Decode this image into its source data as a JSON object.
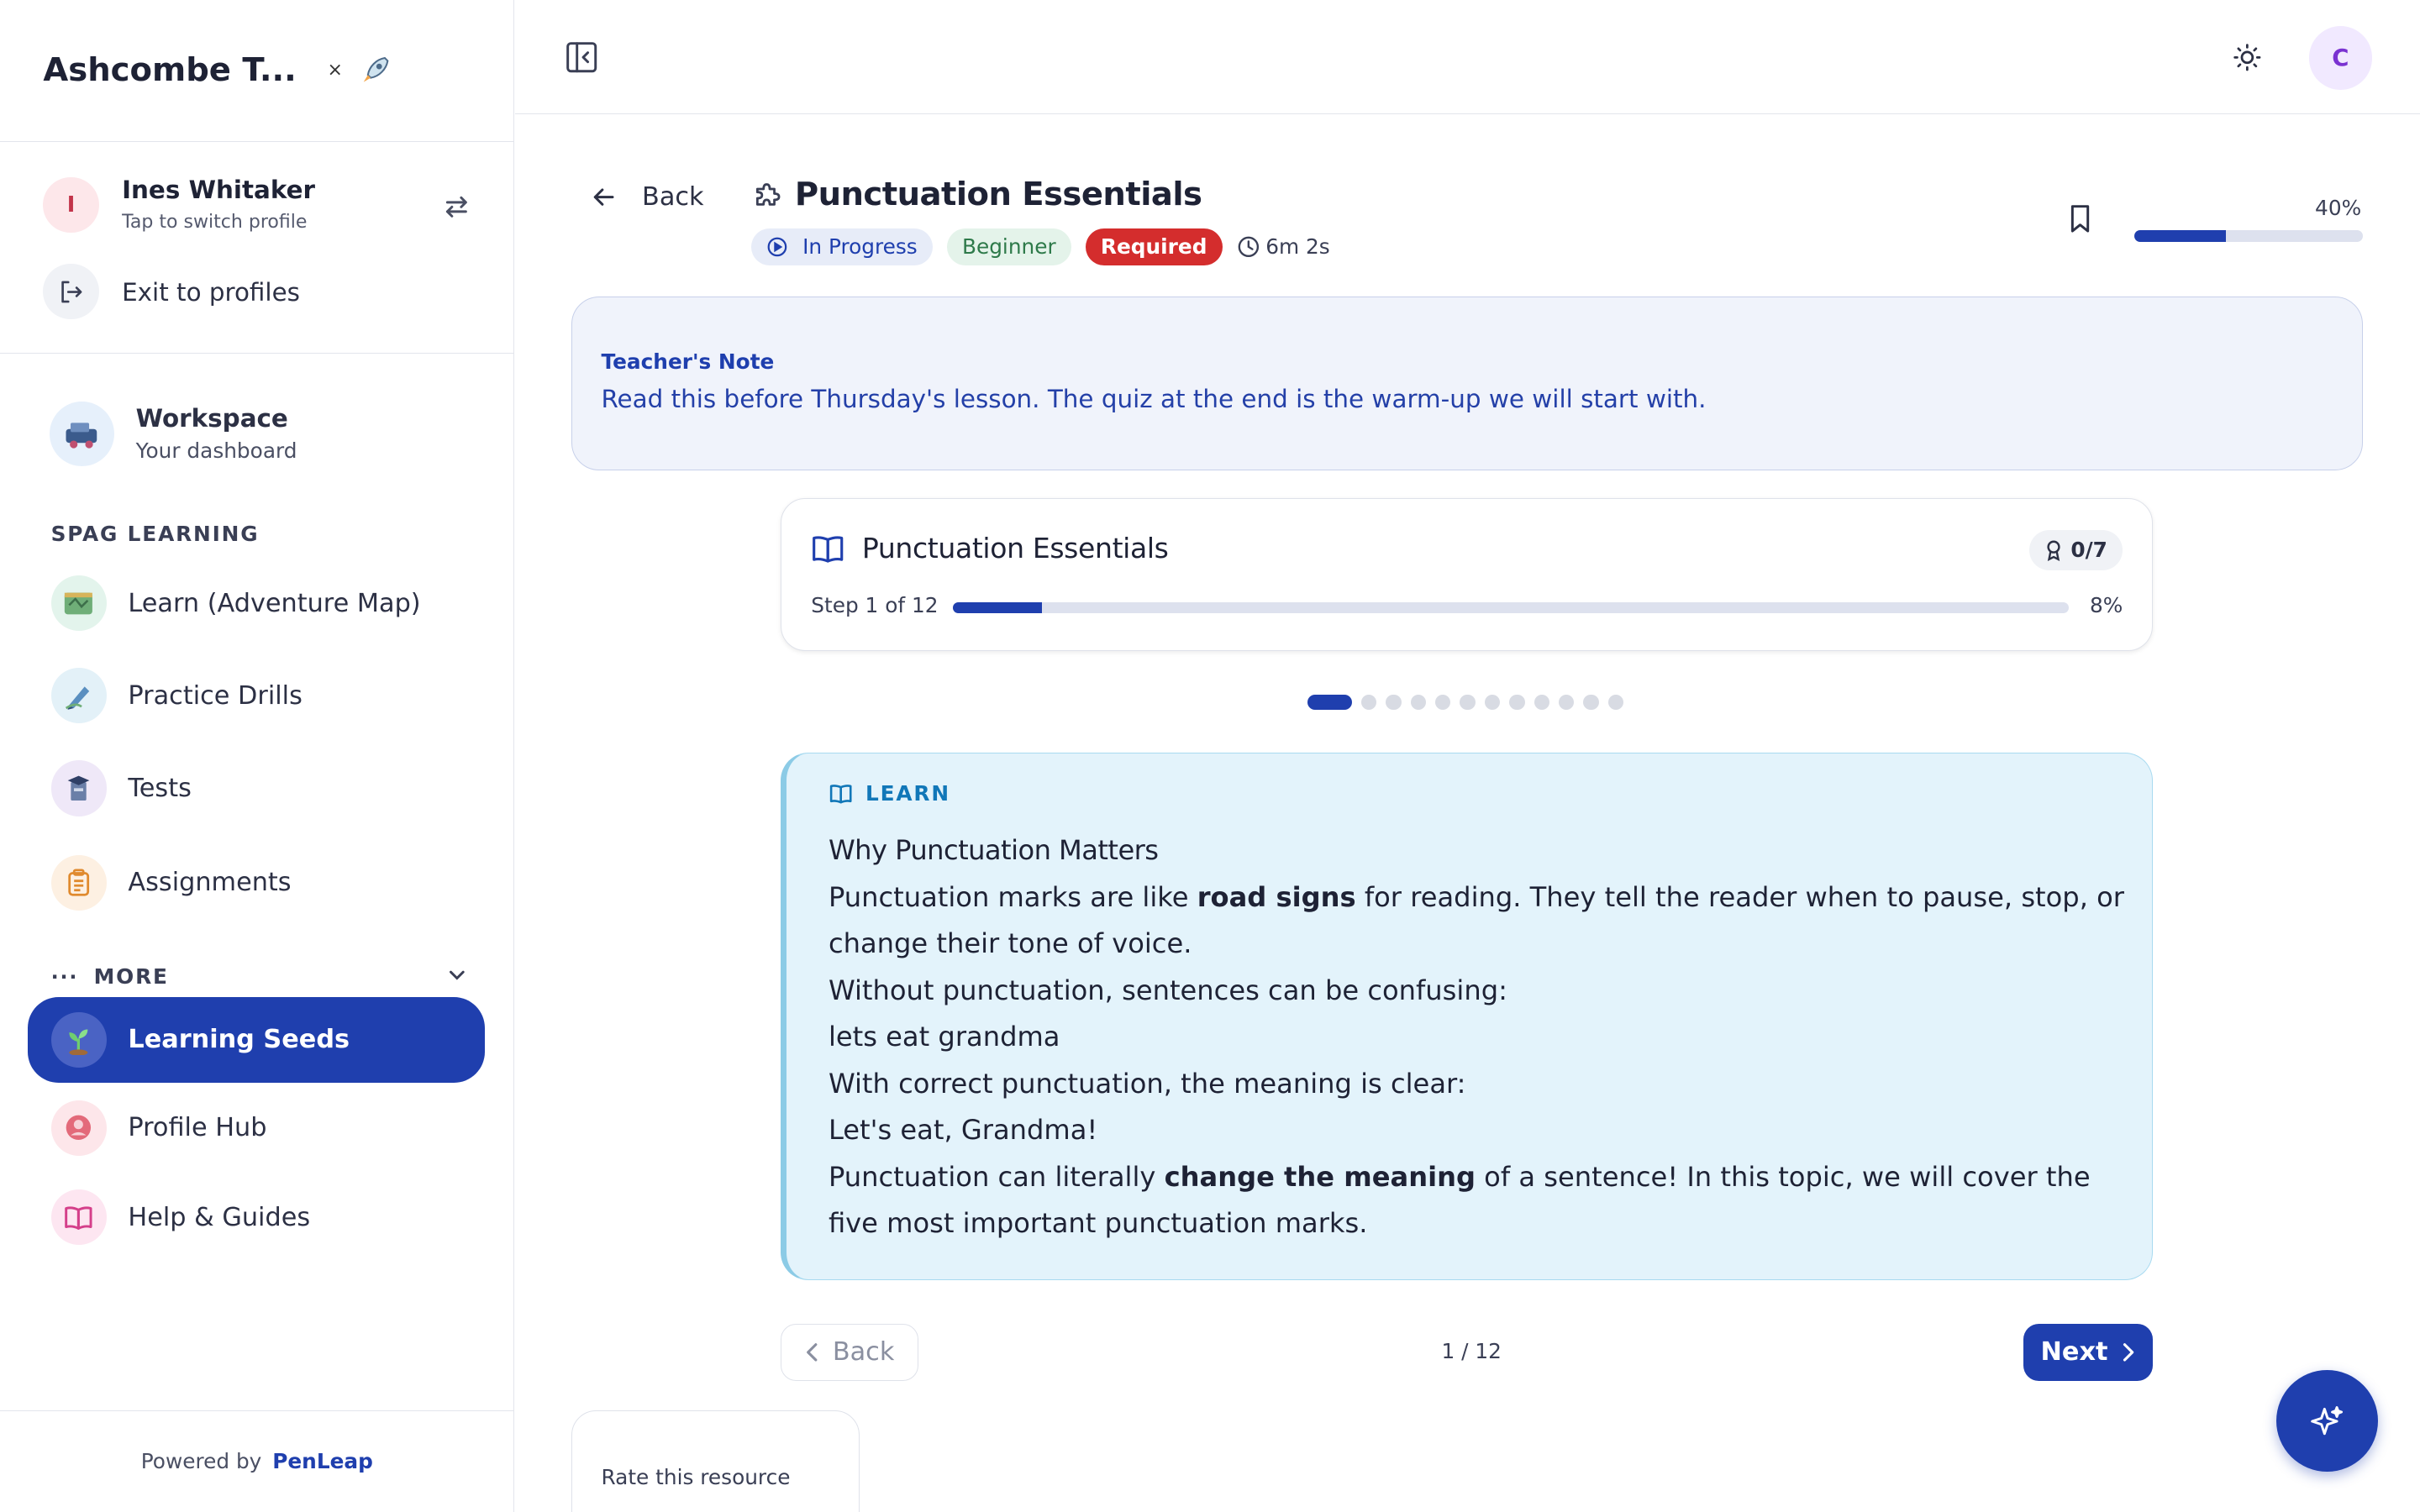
{
  "brand": {
    "title": "Ashcombe T...",
    "close": "×"
  },
  "profile": {
    "initial": "I",
    "name": "Ines Whitaker",
    "subtitle": "Tap to switch profile",
    "exit_label": "Exit to profiles"
  },
  "workspace": {
    "title": "Workspace",
    "subtitle": "Your dashboard"
  },
  "sidebar": {
    "section_label": "SPAG LEARNING",
    "items": [
      {
        "label": "Learn (Adventure Map)"
      },
      {
        "label": "Practice Drills"
      },
      {
        "label": "Tests"
      },
      {
        "label": "Assignments"
      }
    ],
    "more_label": "MORE",
    "more_items": [
      {
        "label": "Learning Seeds",
        "active": true
      },
      {
        "label": "Profile Hub"
      },
      {
        "label": "Help & Guides"
      }
    ],
    "powered_by": "Powered by",
    "powered_brand": "PenLeap"
  },
  "header": {
    "user_initial": "C"
  },
  "lesson": {
    "back_label": "Back",
    "title": "Punctuation Essentials",
    "status": "In Progress",
    "level": "Beginner",
    "required": "Required",
    "time": "6m 2s",
    "progress_pct_label": "40%",
    "progress_fraction": 0.4
  },
  "teacher_note": {
    "title": "Teacher's Note",
    "text": "Read this before Thursday's lesson. The quiz at the end is the warm-up we will start with."
  },
  "step_card": {
    "title": "Punctuation Essentials",
    "score": "0/7",
    "step_label": "Step 1 of 12",
    "pct_label": "8%",
    "progress_fraction": 0.08,
    "total_steps": 12,
    "current_step": 1
  },
  "learn": {
    "tag": "LEARN",
    "heading": "Why Punctuation Matters",
    "p1_a": "Punctuation marks are like ",
    "p1_bold": "road signs",
    "p1_b": " for reading. They tell the reader when to pause, stop, or change their tone of voice.",
    "p2": "Without punctuation, sentences can be confusing:",
    "p3": "lets eat grandma",
    "p4": "With correct punctuation, the meaning is clear:",
    "p5": "Let's eat, Grandma!",
    "p6_a": "Punctuation can literally ",
    "p6_bold": "change the meaning",
    "p6_b": " of a sentence! In this topic, we will cover the five most important punctuation marks."
  },
  "pager": {
    "back_label": "Back",
    "count": "1 / 12",
    "next_label": "Next"
  },
  "rating": {
    "label": "Rate this resource"
  },
  "colors": {
    "primary": "#1f3fae",
    "required": "#d42d2d",
    "learn_bg": "#e3f3fb"
  }
}
